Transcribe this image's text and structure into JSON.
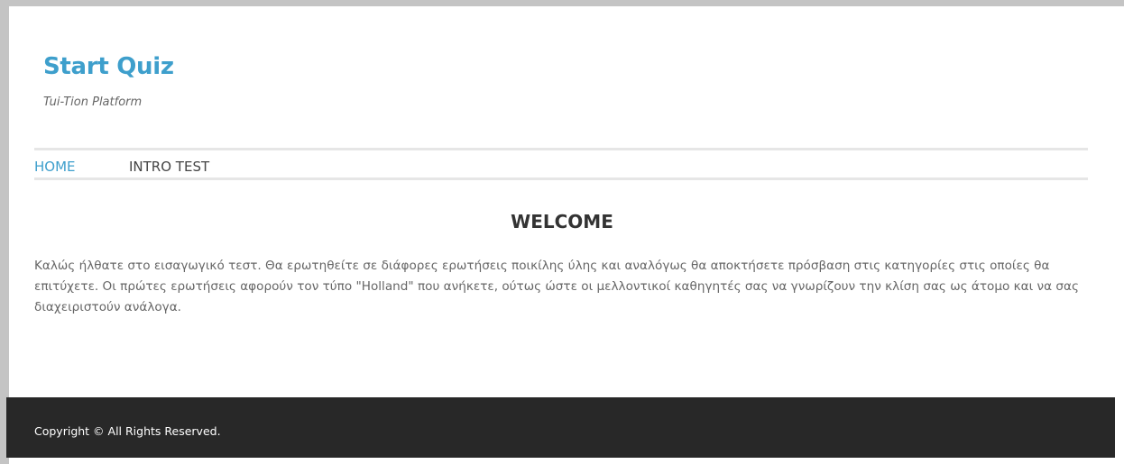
{
  "header": {
    "site_title": "Start Quiz",
    "tagline": "Tui-Tion Platform"
  },
  "nav": {
    "items": [
      {
        "label": "HOME",
        "active": true
      },
      {
        "label": "INTRO TEST",
        "active": false
      }
    ]
  },
  "main": {
    "heading": "WELCOME",
    "paragraph": "Καλώς ήλθατε στο εισαγωγικό τεστ. Θα ερωτηθείτε σε διάφορες ερωτήσεις ποικίλης ύλης και αναλόγως θα αποκτήσετε πρόσβαση στις κατηγορίες στις οποίες θα επιτύχετε. Οι πρώτες ερωτήσεις αφορούν τον τύπο \"Holland\" που ανήκετε, ούτως ώστε οι μελλοντικοί καθηγητές σας να γνωρίζουν την κλίση σας ως άτομο και να σας διαχειριστούν ανάλογα."
  },
  "footer": {
    "copyright": "Copyright © All Rights Reserved."
  },
  "colors": {
    "accent": "#3e9fcc",
    "footer_bg": "#282828",
    "body_text": "#666666",
    "outer_bg": "#c4c4c4"
  }
}
